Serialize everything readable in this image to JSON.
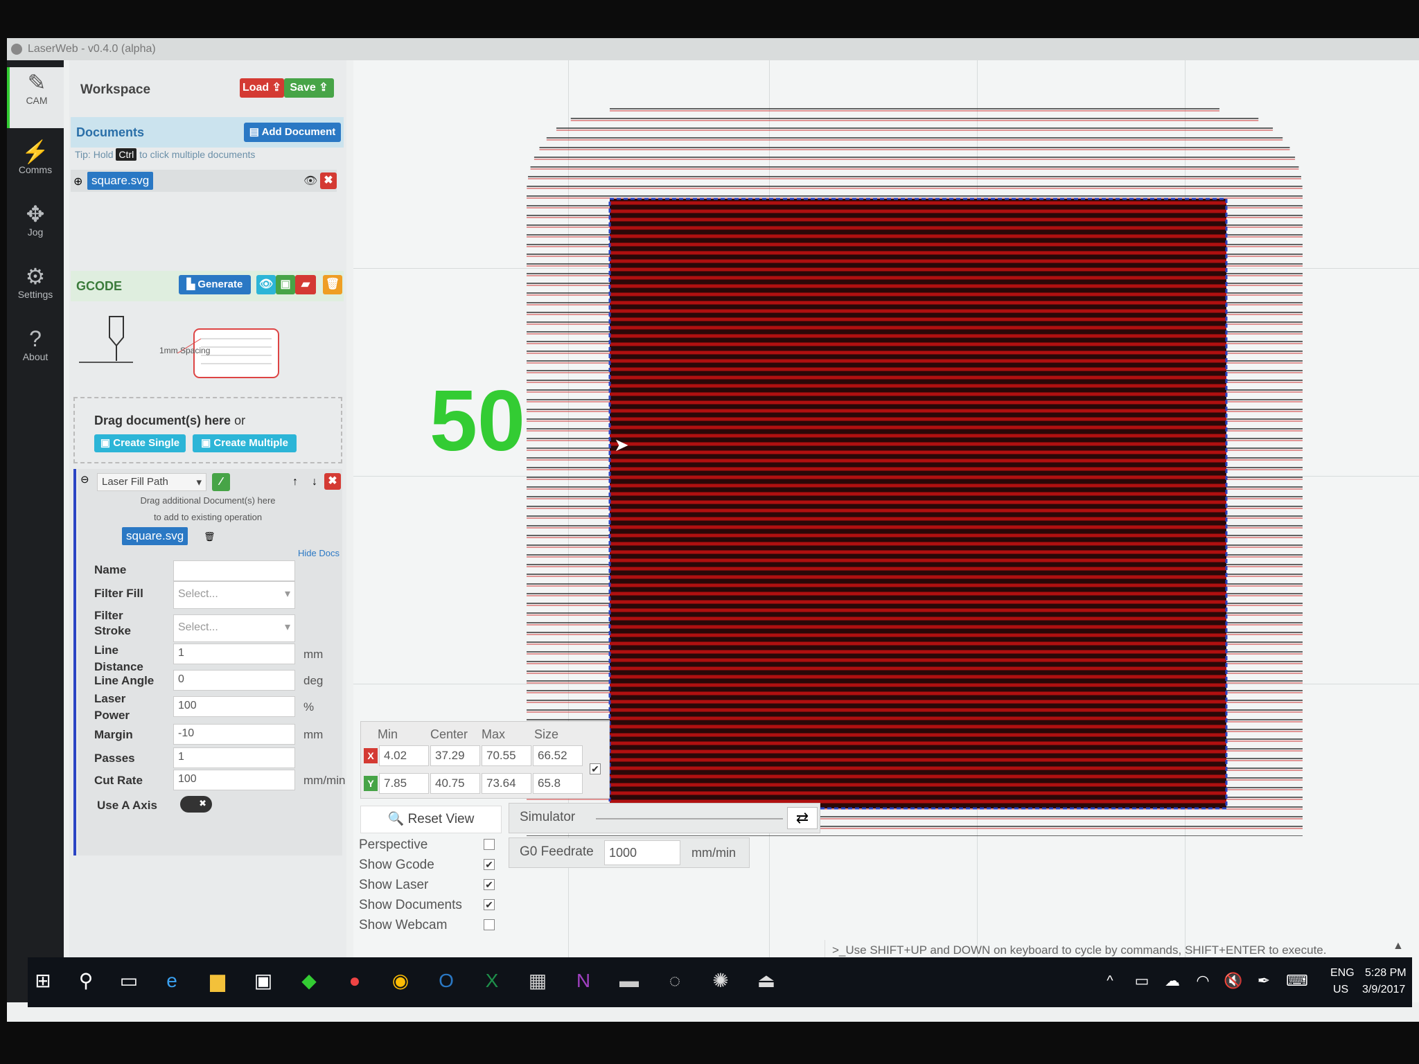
{
  "window": {
    "title": "LaserWeb - v0.4.0 (alpha)"
  },
  "sidebar": {
    "items": [
      {
        "label": "CAM",
        "icon": "edit-icon"
      },
      {
        "label": "Comms",
        "icon": "plug-icon"
      },
      {
        "label": "Jog",
        "icon": "arrows-icon"
      },
      {
        "label": "Settings",
        "icon": "gear-icon"
      },
      {
        "label": "About",
        "icon": "question-icon"
      }
    ]
  },
  "workspace": {
    "title": "Workspace",
    "load_label": "Load",
    "save_label": "Save"
  },
  "documents": {
    "title": "Documents",
    "add_label": "Add Document",
    "tip_prefix": "Tip: Hold",
    "tip_key": "Ctrl",
    "tip_suffix": "to click multiple documents",
    "items": [
      "square.svg"
    ]
  },
  "gcode": {
    "title": "GCODE",
    "generate_label": "Generate",
    "spacing_label": "1mm Spacing"
  },
  "drag": {
    "text": "Drag document(s) here",
    "or": "or",
    "create_single": "Create Single",
    "create_multiple": "Create Multiple"
  },
  "operation": {
    "type": "Laser Fill Path",
    "drag_hint_1": "Drag additional Document(s) here",
    "drag_hint_2": "to add to existing operation",
    "doc": "square.svg",
    "hide_docs": "Hide Docs",
    "fields": {
      "name": {
        "label": "Name",
        "value": ""
      },
      "filter_fill": {
        "label": "Filter Fill",
        "placeholder": "Select..."
      },
      "filter_stroke": {
        "label1": "Filter",
        "label2": "Stroke",
        "placeholder": "Select..."
      },
      "line_distance": {
        "label1": "Line",
        "label2": "Distance",
        "value": "1",
        "unit": "mm"
      },
      "line_angle": {
        "label": "Line Angle",
        "value": "0",
        "unit": "deg"
      },
      "laser_power": {
        "label1": "Laser",
        "label2": "Power",
        "value": "100",
        "unit": "%"
      },
      "margin": {
        "label": "Margin",
        "value": "-10",
        "unit": "mm"
      },
      "passes": {
        "label": "Passes",
        "value": "1"
      },
      "cut_rate": {
        "label": "Cut Rate",
        "value": "100",
        "unit": "mm/min"
      },
      "use_a_axis": {
        "label": "Use A Axis"
      }
    }
  },
  "overlay": {
    "number": "50"
  },
  "stats": {
    "headers": [
      "Min",
      "Center",
      "Max",
      "Size"
    ],
    "x": {
      "axis": "X",
      "min": "4.02",
      "center": "37.29",
      "max": "70.55",
      "size": "66.52"
    },
    "y": {
      "axis": "Y",
      "min": "7.85",
      "center": "40.75",
      "max": "73.64",
      "size": "65.8"
    }
  },
  "view": {
    "reset_label": "Reset View",
    "toggles": [
      {
        "label": "Perspective",
        "checked": false
      },
      {
        "label": "Show Gcode",
        "checked": true
      },
      {
        "label": "Show Laser",
        "checked": true
      },
      {
        "label": "Show Documents",
        "checked": true
      },
      {
        "label": "Show Webcam",
        "checked": false
      }
    ]
  },
  "simulator": {
    "label": "Simulator",
    "feedrate_label": "G0 Feedrate",
    "feedrate_value": "1000",
    "feedrate_unit": "mm/min"
  },
  "console": {
    "hint": ">_Use SHIFT+UP and DOWN on keyboard to cycle by commands, SHIFT+ENTER to execute."
  },
  "taskbar": {
    "lang1": "ENG",
    "lang2": "US",
    "time": "5:28 PM",
    "date": "3/9/2017"
  },
  "colors": {
    "accent_green": "#33cc33",
    "laser_red": "#b01010",
    "button_blue": "#2a78c4"
  }
}
